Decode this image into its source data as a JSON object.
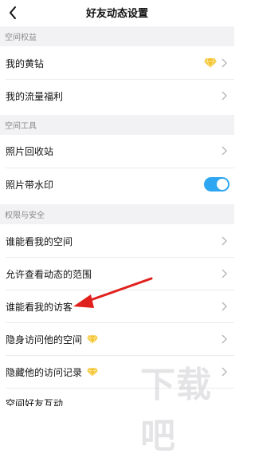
{
  "header": {
    "title": "好友动态设置"
  },
  "sections": {
    "space_rights": "空间权益",
    "space_tools": "空间工具",
    "privacy": "权限与安全"
  },
  "rows": {
    "yellow_diamond": "我的黄钻",
    "traffic_benefit": "我的流量福利",
    "photo_recycle": "照片回收站",
    "photo_watermark": "照片带水印",
    "who_can_see_space": "谁能看我的空间",
    "allow_view_range": "允许查看动态的范围",
    "who_can_see_visitors": "谁能看我的访客",
    "invisible_visit": "隐身访问他的空间",
    "hide_visit_record": "隐藏他的访问记录",
    "space_friend_interaction": "空间好友互动"
  },
  "toggles": {
    "photo_watermark": true
  },
  "colors": {
    "accent": "#2ea7f2",
    "gem": "#f2c230",
    "annotation_arrow": "#e0201c"
  },
  "icons": {
    "back": "back-chevron-icon",
    "row_arrow": "chevron-right-icon",
    "vip": "yellow-diamond-icon"
  }
}
